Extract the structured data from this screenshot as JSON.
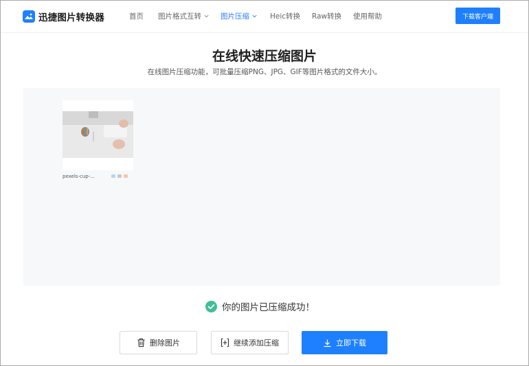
{
  "header": {
    "app_title": "迅捷图片转换器",
    "nav": [
      {
        "label": "首页",
        "has_dropdown": false,
        "active": false
      },
      {
        "label": "图片格式互转",
        "has_dropdown": true,
        "active": false
      },
      {
        "label": "图片压缩",
        "has_dropdown": true,
        "active": true
      },
      {
        "label": "Heic转换",
        "has_dropdown": false,
        "active": false
      },
      {
        "label": "Raw转换",
        "has_dropdown": false,
        "active": false
      },
      {
        "label": "使用帮助",
        "has_dropdown": false,
        "active": false
      }
    ],
    "download_client_label": "下载客户端"
  },
  "main": {
    "title": "在线快速压缩图片",
    "subtitle": "在线图片压缩功能，可批量压缩PNG、JPG、GIF等图片格式的文件大小。",
    "file": {
      "name": "pexels-cup-..."
    },
    "success_message": "你的图片已压缩成功！",
    "buttons": {
      "delete_label": "删除图片",
      "continue_label": "继续添加压缩",
      "download_label": "立即下载"
    }
  },
  "colors": {
    "accent": "#1e80ff",
    "success": "#3fbf95",
    "panel_bg": "#f7f8fa"
  },
  "icons": {
    "logo": "image-logo-icon",
    "success": "check-circle-icon",
    "delete": "trash-icon",
    "continue": "add-file-icon",
    "download": "download-icon"
  }
}
